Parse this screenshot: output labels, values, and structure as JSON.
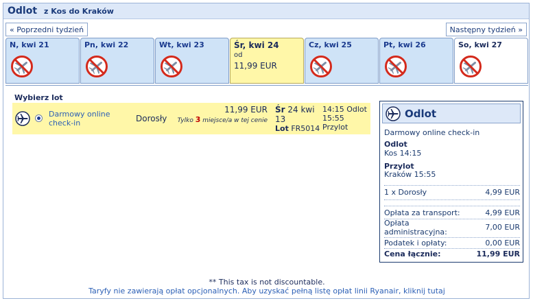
{
  "header": {
    "title": "Odlot",
    "route": "z Kos do Kraków"
  },
  "nav": {
    "prev_label": "« Poprzedni tydzień",
    "next_label": "Następny tydzień »"
  },
  "days": [
    {
      "label": "N, kwi 21",
      "available": false
    },
    {
      "label": "Pn, kwi 22",
      "available": false
    },
    {
      "label": "Wt, kwi 23",
      "available": false
    },
    {
      "label": "Śr, kwi 24",
      "available": true,
      "from": "od",
      "price": "11,99 EUR",
      "selected": true
    },
    {
      "label": "Cz, kwi 25",
      "available": false
    },
    {
      "label": "Pt, kwi 26",
      "available": false
    },
    {
      "label": "So, kwi 27",
      "available": false
    }
  ],
  "flights": {
    "heading": "Wybierz lot",
    "row": {
      "checkin": "Darmowy online check-in",
      "passenger": "Dorosły",
      "price": "11,99 EUR",
      "seats_before": "Tylko ",
      "seats_count": "3",
      "seats_after": " miejsce/a w tej cenie",
      "day_abbr": "Śr",
      "day_rest": " 24 kwi",
      "day_num": "13",
      "lot_label": "Lot",
      "flight_no": " FR5014",
      "dep_time": "14:15",
      "dep_label": "Odlot",
      "arr_time": "15:55",
      "arr_label": "Przylot"
    }
  },
  "summary": {
    "title": "Odlot",
    "checkin": "Darmowy online check-in",
    "dep_label": "Odlot",
    "dep_detail": "Kos 14:15",
    "arr_label": "Przylot",
    "arr_detail": "Kraków 15:55",
    "fare_label": "1 x Dorosły",
    "fare_value": "4,99 EUR",
    "transport_label": "Opłata za transport:",
    "transport_value": "4,99 EUR",
    "admin_label1": "Opłata",
    "admin_label2": "administracyjna:",
    "admin_value": "7,00 EUR",
    "tax_label": "Podatek i opłaty:",
    "tax_value": "0,00 EUR",
    "total_label": "Cena łącznie:",
    "total_value": "11,99 EUR"
  },
  "footer": {
    "note": "** This tax is not discountable.",
    "link": "Taryfy nie zawierają opłat opcjonalnych. Aby uzyskać pełną listę opłat linii Ryanair, kliknij tutaj"
  },
  "icons": {
    "no_flight": "no-flight-icon",
    "plane": "plane-icon"
  },
  "colors": {
    "selected_day": "#fff7a8",
    "day_tab": "#cfe3f7",
    "header": "#dde8f8",
    "no_flight": "#d42a1c"
  }
}
